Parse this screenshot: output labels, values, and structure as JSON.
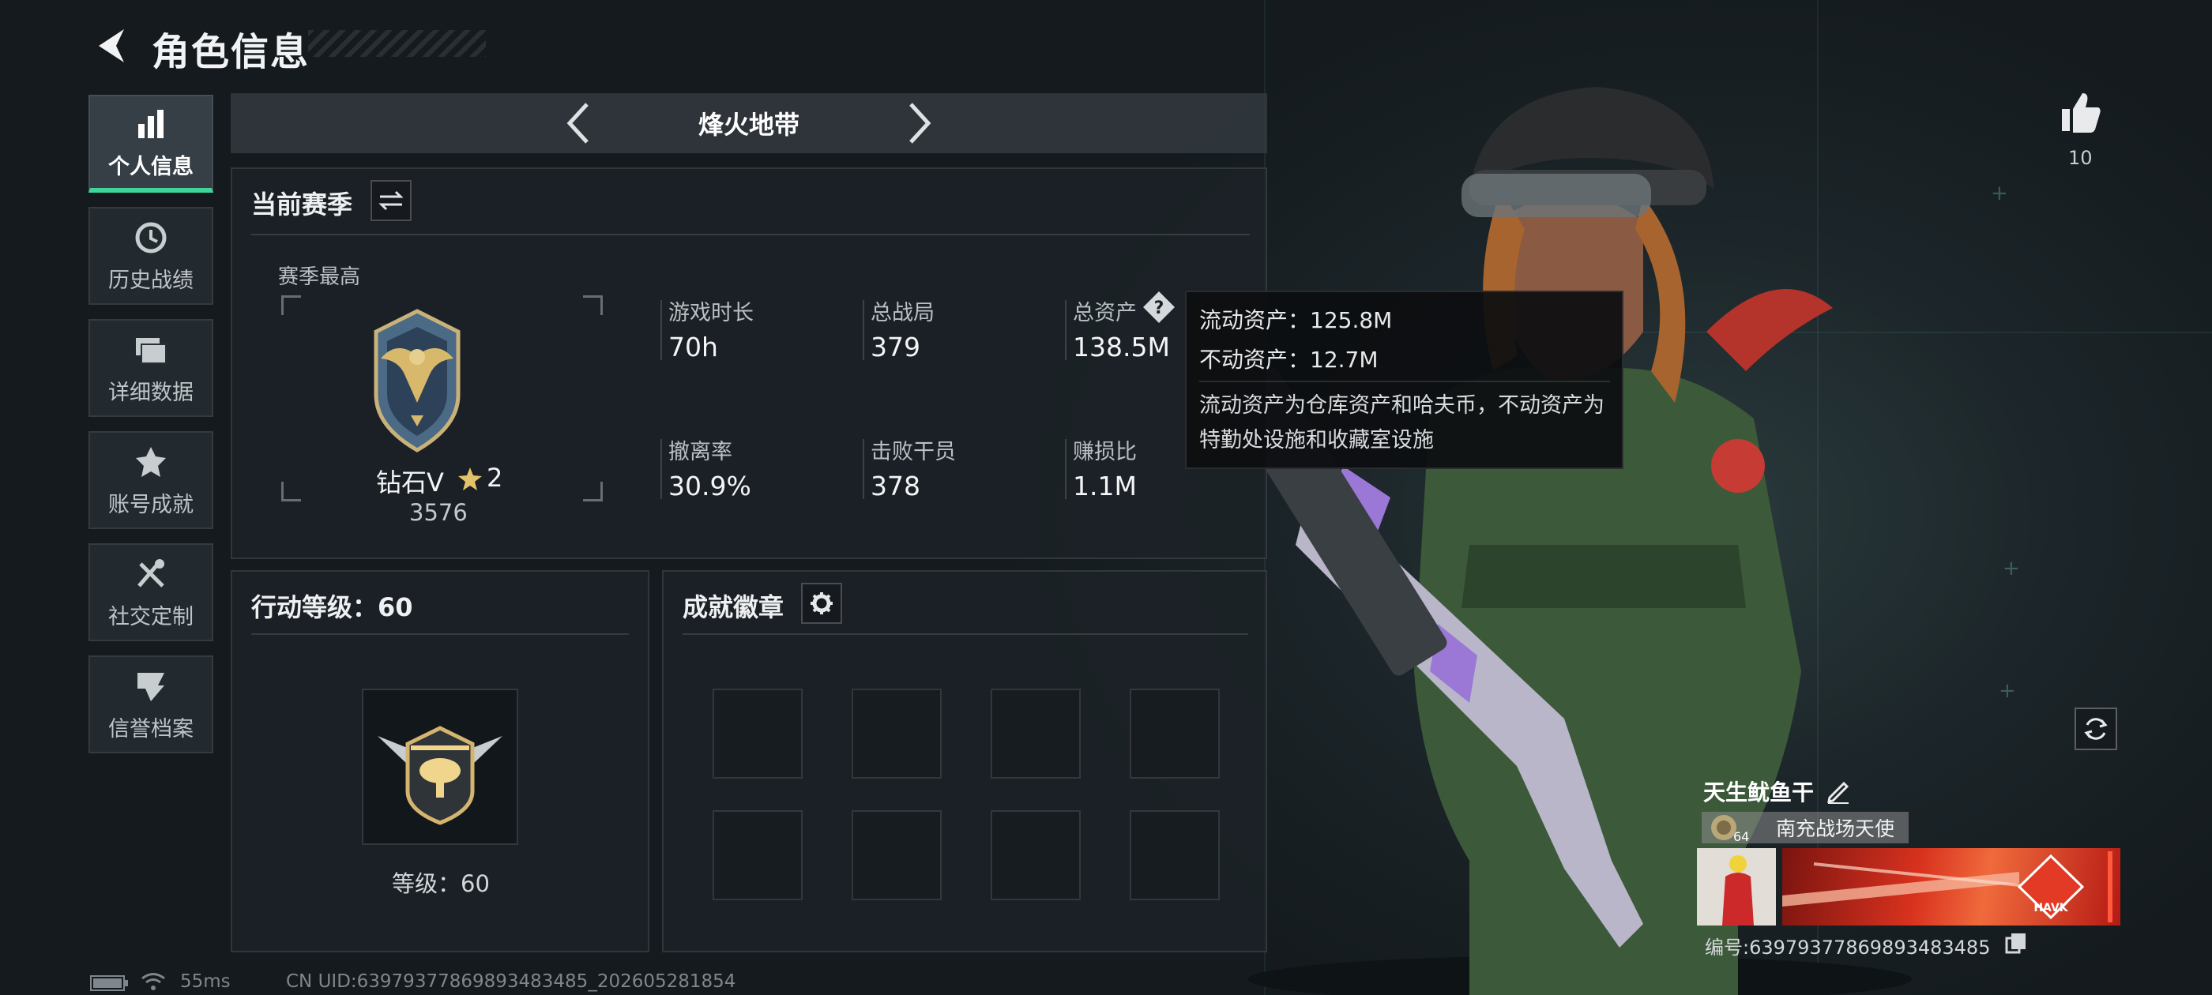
{
  "header": {
    "title": "角色信息"
  },
  "sidebar": {
    "items": [
      {
        "label": "个人信息",
        "icon": "bar-chart-icon",
        "active": true
      },
      {
        "label": "历史战绩",
        "icon": "history-clock-icon",
        "active": false
      },
      {
        "label": "详细数据",
        "icon": "folder-icon",
        "active": false
      },
      {
        "label": "账号成就",
        "icon": "achievement-star-icon",
        "active": false
      },
      {
        "label": "社交定制",
        "icon": "tools-icon",
        "active": false
      },
      {
        "label": "信誉档案",
        "icon": "shield-check-icon",
        "active": false
      }
    ]
  },
  "mode": {
    "name": "烽火地带"
  },
  "season": {
    "title": "当前赛季",
    "best_label": "赛季最高",
    "rank_name": "钻石V",
    "rank_stars": "2",
    "rank_score": "3576",
    "stats": {
      "play_time_label": "游戏时长",
      "play_time": "70h",
      "total_games_label": "总战局",
      "total_games": "379",
      "total_assets_label": "总资产",
      "total_assets": "138.5M",
      "extract_rate_label": "撤离率",
      "extract_rate": "30.9%",
      "kills_label": "击败干员",
      "kills": "378",
      "profit_ratio_label": "赚损比",
      "profit_ratio": "1.1M"
    }
  },
  "tooltip": {
    "liquid": "流动资产：125.8M",
    "fixed": "不动资产：12.7M",
    "desc": "流动资产为仓库资产和哈夫币，不动资产为特勤处设施和收藏室设施"
  },
  "action_level": {
    "title": "行动等级：60",
    "level_text": "等级：60"
  },
  "achievements": {
    "title": "成就徽章"
  },
  "status": {
    "ping": "55ms",
    "uid": "CN UID:63979377869893483485_202605281854"
  },
  "likes": {
    "count": "10"
  },
  "player": {
    "name": "天生鱿鱼干",
    "title": "南充战场天使",
    "level": "64",
    "id": "编号:63979377869893483485",
    "card_brand": "HAVK"
  },
  "colors": {
    "accent": "#3fd49a",
    "background": "#1a1f24",
    "card_red": "#d8321e"
  }
}
